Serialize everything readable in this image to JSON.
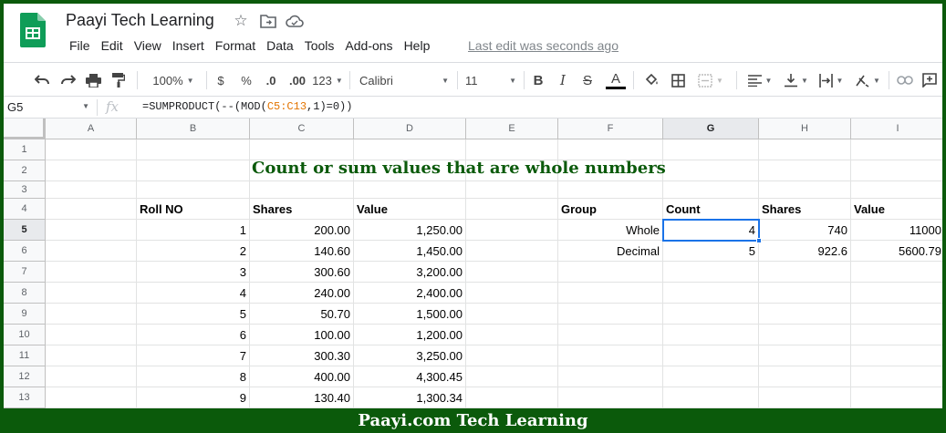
{
  "app": {
    "title": "Paayi Tech Learning",
    "last_edit": "Last edit was seconds ago",
    "menu": [
      "File",
      "Edit",
      "View",
      "Insert",
      "Format",
      "Data",
      "Tools",
      "Add-ons",
      "Help"
    ]
  },
  "toolbar": {
    "zoom": "100%",
    "currency": "$",
    "percent": "%",
    "decrease_decimals": ".0",
    "increase_decimals": ".00",
    "more_formats": "123",
    "font": "Calibri",
    "font_size": "11",
    "bold": "B",
    "italic": "I",
    "strikethrough": "S",
    "text_color_label": "A"
  },
  "formula_bar": {
    "cell_ref": "G5",
    "fx": "fx",
    "formula_prefix": "=SUMPRODUCT(--(MOD(",
    "formula_range": "C5:C13",
    "formula_suffix": ",1)=0))"
  },
  "grid": {
    "columns": [
      "A",
      "B",
      "C",
      "D",
      "E",
      "F",
      "G",
      "H",
      "I"
    ],
    "selected_column": "G",
    "rows": [
      "1",
      "2",
      "3",
      "4",
      "5",
      "6",
      "7",
      "8",
      "9",
      "10",
      "11",
      "12",
      "13"
    ],
    "selected_row": "5",
    "title": "Count or sum values that are whole numbers",
    "headers": {
      "b": "Roll NO",
      "c": "Shares",
      "d": "Value"
    },
    "data": [
      {
        "b": "1",
        "c": "200.00",
        "d": "1,250.00"
      },
      {
        "b": "2",
        "c": "140.60",
        "d": "1,450.00"
      },
      {
        "b": "3",
        "c": "300.60",
        "d": "3,200.00"
      },
      {
        "b": "4",
        "c": "240.00",
        "d": "2,400.00"
      },
      {
        "b": "5",
        "c": "50.70",
        "d": "1,500.00"
      },
      {
        "b": "6",
        "c": "100.00",
        "d": "1,200.00"
      },
      {
        "b": "7",
        "c": "300.30",
        "d": "3,250.00"
      },
      {
        "b": "8",
        "c": "400.00",
        "d": "4,300.45"
      },
      {
        "b": "9",
        "c": "130.40",
        "d": "1,300.34"
      }
    ],
    "summary_headers": {
      "f": "Group",
      "g": "Count",
      "h": "Shares",
      "i": "Value"
    },
    "summary": [
      {
        "f": "Whole",
        "g": "4",
        "h": "740",
        "i": "11000"
      },
      {
        "f": "Decimal",
        "g": "5",
        "h": "922.6",
        "i": "5600.79"
      }
    ]
  },
  "footer": "Paayi.com Tech Learning",
  "colors": {
    "title_green": "#0b5a0b",
    "selection_blue": "#1a73e8",
    "sheets_green": "#0f9d58"
  }
}
